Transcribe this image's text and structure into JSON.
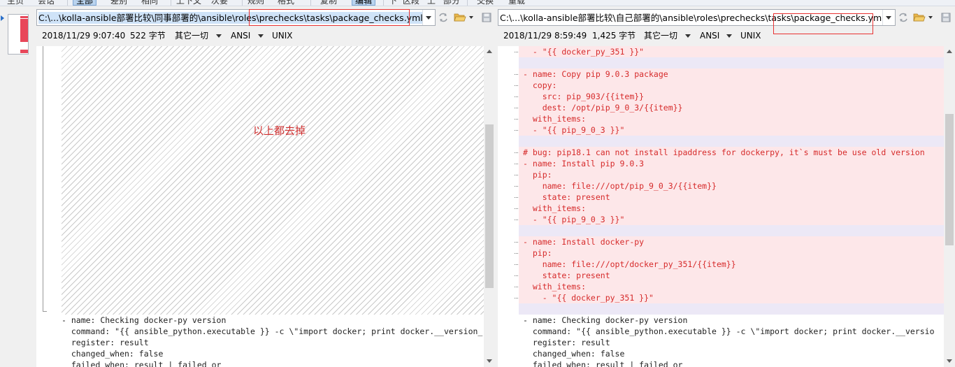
{
  "toolbar": {
    "items": [
      "主页",
      "会话",
      "全部",
      "差别",
      "相同",
      "上下文",
      "次要",
      "规则",
      "格式",
      "复制",
      "编辑",
      "下",
      "区段",
      "上",
      "部分",
      "交换",
      "重载"
    ],
    "active": [
      "全部",
      "编辑"
    ]
  },
  "left": {
    "path_prefix": "C:\\...\\kolla-ansible部署比较\\同事部署的\\ansible\\roles\\",
    "path_highlight": "prechecks\\tasks\\package_checks.yml",
    "date": "2018/11/29 9:07:40",
    "size": "522 字节",
    "eol_mode": "其它一切",
    "encoding": "ANSI",
    "line_ending": "UNIX",
    "annotation": "以上都去掉",
    "code_lines": [
      "- name: Checking docker-py version",
      "  command: \"{{ ansible_python.executable }} -c \\\"import docker; print docker.__version_",
      "  register: result",
      "  changed_when: false",
      "  failed_when: result | failed or"
    ]
  },
  "right": {
    "path_prefix": "C:\\...\\kolla-ansible部署比较\\自己部署的\\ansible\\roles\\prechecks\\tasks",
    "path_highlight": "\\package_checks.yml",
    "date": "2018/11/29 8:59:49",
    "size": "1,425 字节",
    "eol_mode": "其它一切",
    "encoding": "ANSI",
    "line_ending": "UNIX",
    "diff_lines": [
      "  - \"{{ docker_py_351 }}\"",
      "",
      "- name: Copy pip 9.0.3 package",
      "  copy:",
      "    src: pip_903/{{item}}",
      "    dest: /opt/pip_9_0_3/{{item}}",
      "  with_items:",
      "  - \"{{ pip_9_0_3 }}\"",
      "",
      "# bug: pip18.1 can not install ipaddress for dockerpy, it`s must be use old version",
      "- name: Install pip 9.0.3",
      "  pip:",
      "    name: file:///opt/pip_9_0_3/{{item}}",
      "    state: present",
      "  with_items:",
      "  - \"{{ pip_9_0_3 }}\"",
      "",
      "- name: Install docker-py",
      "  pip:",
      "    name: file:///opt/docker_py_351/{{item}}",
      "    state: present",
      "  with_items:",
      "    - \"{{ docker_py_351 }}\"",
      ""
    ],
    "code_lines": [
      "- name: Checking docker-py version",
      "  command: \"{{ ansible_python.executable }} -c \\\"import docker; print docker.__versio",
      "  register: result",
      "  changed_when: false",
      "  failed_when: result | failed or"
    ]
  },
  "colors": {
    "diff_text": "#d62a2a",
    "diff_bg": "#fde7e9",
    "highlight_box": "#e83333",
    "path_selection": "#cfe3f8"
  }
}
